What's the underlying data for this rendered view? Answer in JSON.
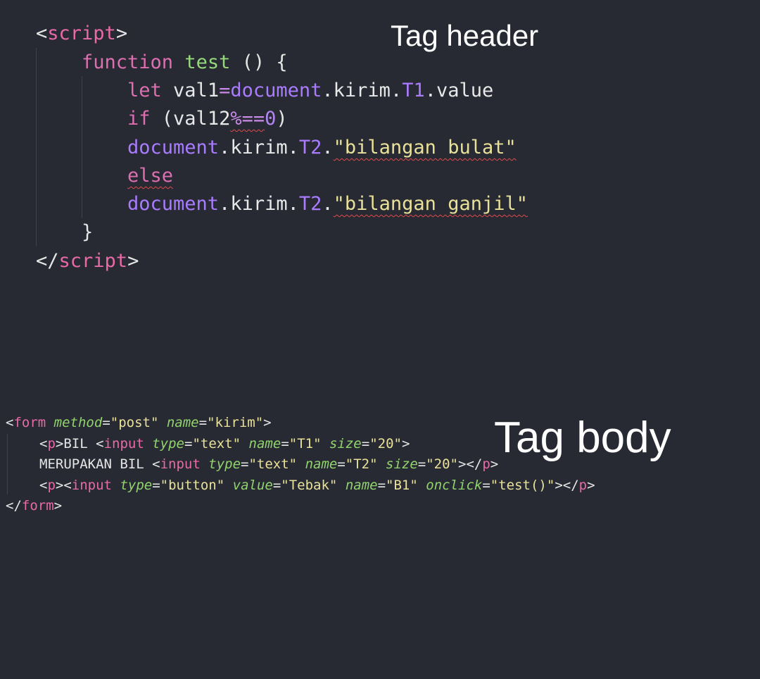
{
  "headings": {
    "header": "Tag header",
    "body": "Tag body"
  },
  "script_code": {
    "open_tag": "script",
    "close_tag": "script",
    "fn_keyword": "function",
    "fn_name": "test",
    "fn_sig": " () {",
    "let_keyword": "let",
    "let_var": "val1",
    "eq": "=",
    "obj_document": "document",
    "obj_kirim": "kirim",
    "prop_t1": "T1",
    "prop_value": "value",
    "if_keyword": "if",
    "paren_open": "(",
    "cond_var": "val12",
    "cond_op": "%==",
    "cond_num": "0",
    "paren_close": ")",
    "prop_t2": "T2",
    "str_bulat": "\"bilangan bulat\"",
    "else_keyword": "else",
    "str_ganjil": "\"bilangan ganjil\"",
    "close_brace": "}"
  },
  "form_code": {
    "tag_form": "form",
    "tag_p": "p",
    "tag_input": "input",
    "attr_method": "method",
    "val_post": "\"post\"",
    "attr_name": "name",
    "val_kirim": "\"kirim\"",
    "text_bil": "BIL ",
    "attr_type": "type",
    "val_text": "\"text\"",
    "val_t1": "\"T1\"",
    "attr_size": "size",
    "val_20": "\"20\"",
    "text_merupakan": "MERUPAKAN BIL ",
    "val_t2": "\"T2\"",
    "val_button": "\"button\"",
    "attr_value": "value",
    "val_tebak": "\"Tebak\"",
    "val_b1": "\"B1\"",
    "attr_onclick": "onclick",
    "val_test": "\"test()\""
  },
  "colors": {
    "background": "#272a33",
    "tag": "#e86aa6",
    "keyword": "#dd6fb1",
    "function_name": "#95d97a",
    "property": "#a97cff",
    "string": "#e9e199",
    "attribute": "#91d36c",
    "error_squiggle": "#e04a4a"
  }
}
